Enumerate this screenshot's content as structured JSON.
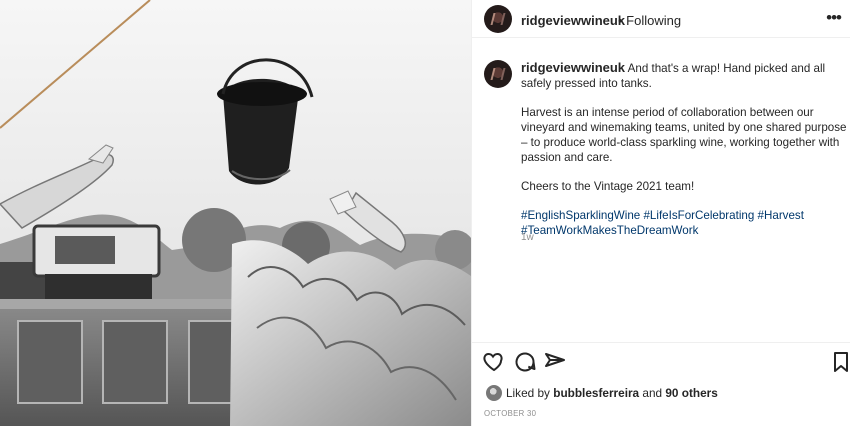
{
  "post": {
    "username": "ridgeviewwineuk",
    "follow_status": "Following",
    "more_icon": "more-options-icon",
    "caption": {
      "username": "ridgeviewwineuk",
      "line1": "And that's a wrap! Hand picked and all safely pressed into tanks.",
      "line2": "Harvest is an intense period of collaboration between our vineyard and winemaking teams, united by one shared purpose – to produce world-class sparkling wine, working together with passion and care.",
      "line3": "Cheers to the Vintage 2021 team!",
      "hashtags": [
        "#EnglishSparklingWine",
        "#LifeIsForCelebrating",
        "#Harvest",
        "#TeamWorkMakesTheDreamWork"
      ]
    },
    "age": "1w",
    "actions": {
      "like_icon": "heart-icon",
      "comment_icon": "comment-icon",
      "share_icon": "share-icon",
      "save_icon": "bookmark-icon"
    },
    "likes": {
      "prefix": "Liked by",
      "user": "bubblesferreira",
      "connector": "and",
      "count": "90 others"
    },
    "date": "OCTOBER 30"
  }
}
